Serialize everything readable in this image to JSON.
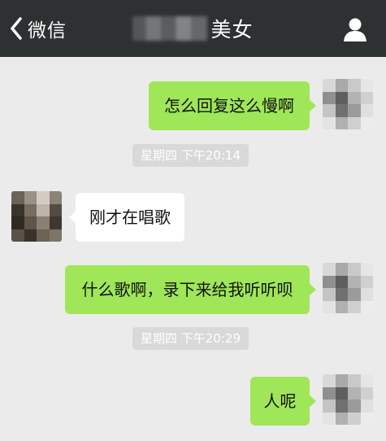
{
  "navbar": {
    "back_label": "微信",
    "title_visible": "美女",
    "back_icon": "chevron-left-icon",
    "profile_icon": "person-icon"
  },
  "messages": [
    {
      "side": "right",
      "text": "怎么回复这么慢啊"
    },
    {
      "type": "time",
      "text": "星期四 下午20:14"
    },
    {
      "side": "left",
      "text": "刚才在唱歌"
    },
    {
      "side": "right",
      "text": "什么歌啊，录下来给我听听呗"
    },
    {
      "type": "time",
      "text": "星期四 下午20:29"
    },
    {
      "side": "right",
      "text": "人呢"
    }
  ],
  "colors": {
    "navbar_bg": "#2e3132",
    "chat_bg": "#ebebeb",
    "bubble_sent": "#9fe658",
    "bubble_received": "#ffffff",
    "timestamp_bg": "#d9d9d9"
  }
}
